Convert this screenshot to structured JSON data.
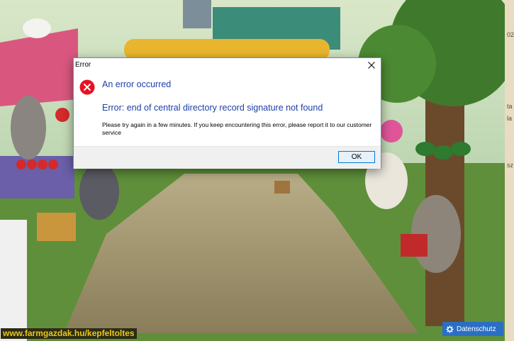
{
  "dialog": {
    "title": "Error",
    "heading": "An error occurred",
    "message": "Error: end of central directory record signature not found",
    "body": "Please try again in a few minutes. If you keep encountering this error, please report it to our customer service",
    "ok_label": "OK"
  },
  "overlay": {
    "watermark": "www.farmgazdak.hu/kepfeltoltes",
    "privacy_label": "Datenschutz"
  },
  "side_strip": [
    "02",
    "ta",
    "la",
    "sz",
    "sz"
  ],
  "colors": {
    "heading": "#1c3fa8",
    "error_icon": "#e81123",
    "privacy_bg": "#2a6fc4",
    "watermark_text": "#e8c81f"
  }
}
